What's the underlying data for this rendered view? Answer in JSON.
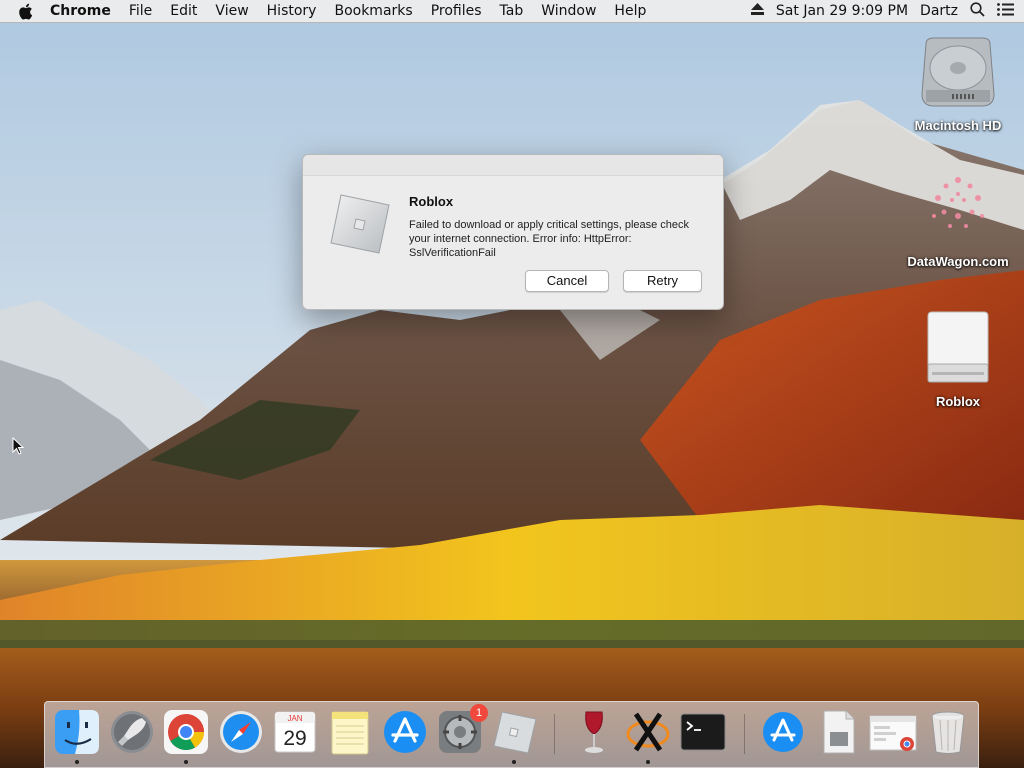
{
  "menubar": {
    "app_name": "Chrome",
    "menus": [
      "File",
      "Edit",
      "View",
      "History",
      "Bookmarks",
      "Profiles",
      "Tab",
      "Window",
      "Help"
    ],
    "clock": "Sat Jan 29  9:09 PM",
    "user": "Dartz",
    "icons": [
      "apple-icon",
      "eject-icon",
      "spotlight-icon",
      "notification-center-icon"
    ]
  },
  "desktop": {
    "icons": [
      {
        "label": "Macintosh HD",
        "icon": "hard-drive-icon"
      },
      {
        "label": "DataWagon.com",
        "icon": "network-volume-icon"
      },
      {
        "label": "Roblox",
        "icon": "disk-image-icon"
      }
    ]
  },
  "dialog": {
    "title": "Roblox",
    "message": "Failed to download or apply critical settings, please check your internet connection. Error info: HttpError: SslVerificationFail",
    "cancel_label": "Cancel",
    "retry_label": "Retry",
    "icon": "roblox-icon"
  },
  "dock": {
    "items": [
      {
        "name": "Finder",
        "icon": "finder-icon",
        "running": true
      },
      {
        "name": "Launchpad",
        "icon": "launchpad-icon",
        "running": false
      },
      {
        "name": "Google Chrome",
        "icon": "chrome-icon",
        "running": true
      },
      {
        "name": "Safari",
        "icon": "safari-icon",
        "running": false
      },
      {
        "name": "Calendar",
        "icon": "calendar-icon",
        "running": false,
        "month": "JAN",
        "day": "29"
      },
      {
        "name": "Notes",
        "icon": "notes-icon",
        "running": false
      },
      {
        "name": "App Store",
        "icon": "app-store-icon",
        "running": false
      },
      {
        "name": "System Preferences",
        "icon": "system-preferences-icon",
        "running": false,
        "badge": "1"
      },
      {
        "name": "Roblox",
        "icon": "roblox-icon",
        "running": true
      },
      {
        "name": "Wine",
        "icon": "wine-icon",
        "running": false
      },
      {
        "name": "XQuartz",
        "icon": "xquartz-icon",
        "running": true
      },
      {
        "name": "Terminal",
        "icon": "terminal-icon",
        "running": false
      },
      {
        "name": "App Store Downloads",
        "icon": "app-store-folder-icon",
        "running": false
      },
      {
        "name": "Document",
        "icon": "document-icon",
        "running": false
      },
      {
        "name": "Chrome Window",
        "icon": "chrome-window-icon",
        "running": false
      },
      {
        "name": "Trash",
        "icon": "trash-icon",
        "running": false
      }
    ]
  },
  "colors": {
    "menubar": "#ececec",
    "dialog": "#ececec",
    "badge": "#f0483c"
  }
}
